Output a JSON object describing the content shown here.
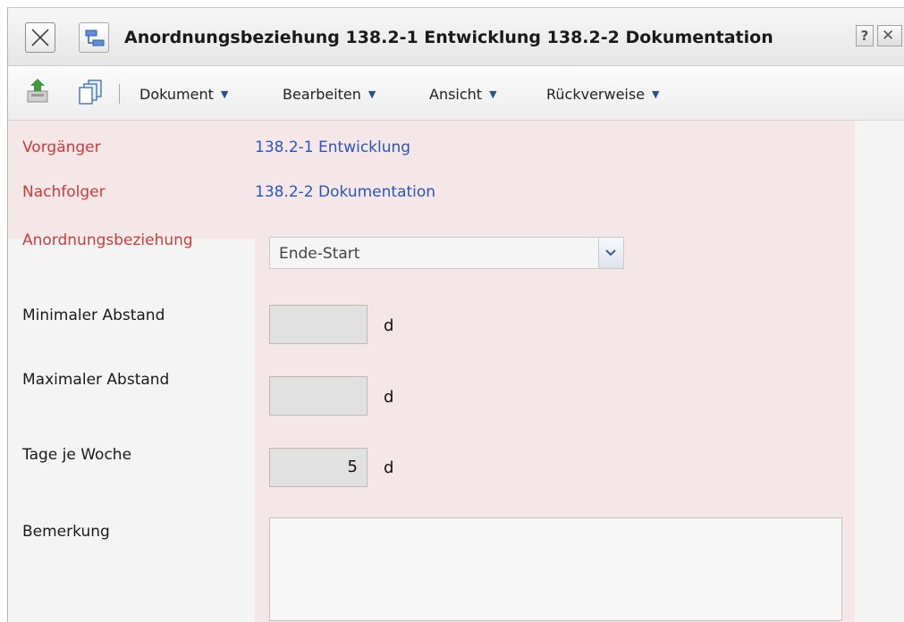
{
  "window": {
    "title": "Anordnungsbeziehung 138.2-1 Entwicklung 138.2-2 Dokumentation",
    "help_label": "?",
    "close_label": "✕"
  },
  "toolbar": {
    "menus": [
      "Dokument",
      "Bearbeiten",
      "Ansicht",
      "Rückverweise"
    ]
  },
  "form": {
    "predecessor_label": "Vorgänger",
    "predecessor_value": "138.2-1 Entwicklung",
    "successor_label": "Nachfolger",
    "successor_value": "138.2-2 Dokumentation",
    "relation_label": "Anordnungsbeziehung",
    "relation_value": "Ende-Start",
    "min_gap_label": "Minimaler Abstand",
    "min_gap_value": "",
    "max_gap_label": "Maximaler Abstand",
    "max_gap_value": "",
    "days_per_week_label": "Tage je Woche",
    "days_per_week_value": "5",
    "unit": "d",
    "remark_label": "Bemerkung",
    "remark_value": ""
  },
  "colors": {
    "required_label": "#d03a3a",
    "link": "#2a55c0",
    "form_background": "#f5e7e7"
  }
}
